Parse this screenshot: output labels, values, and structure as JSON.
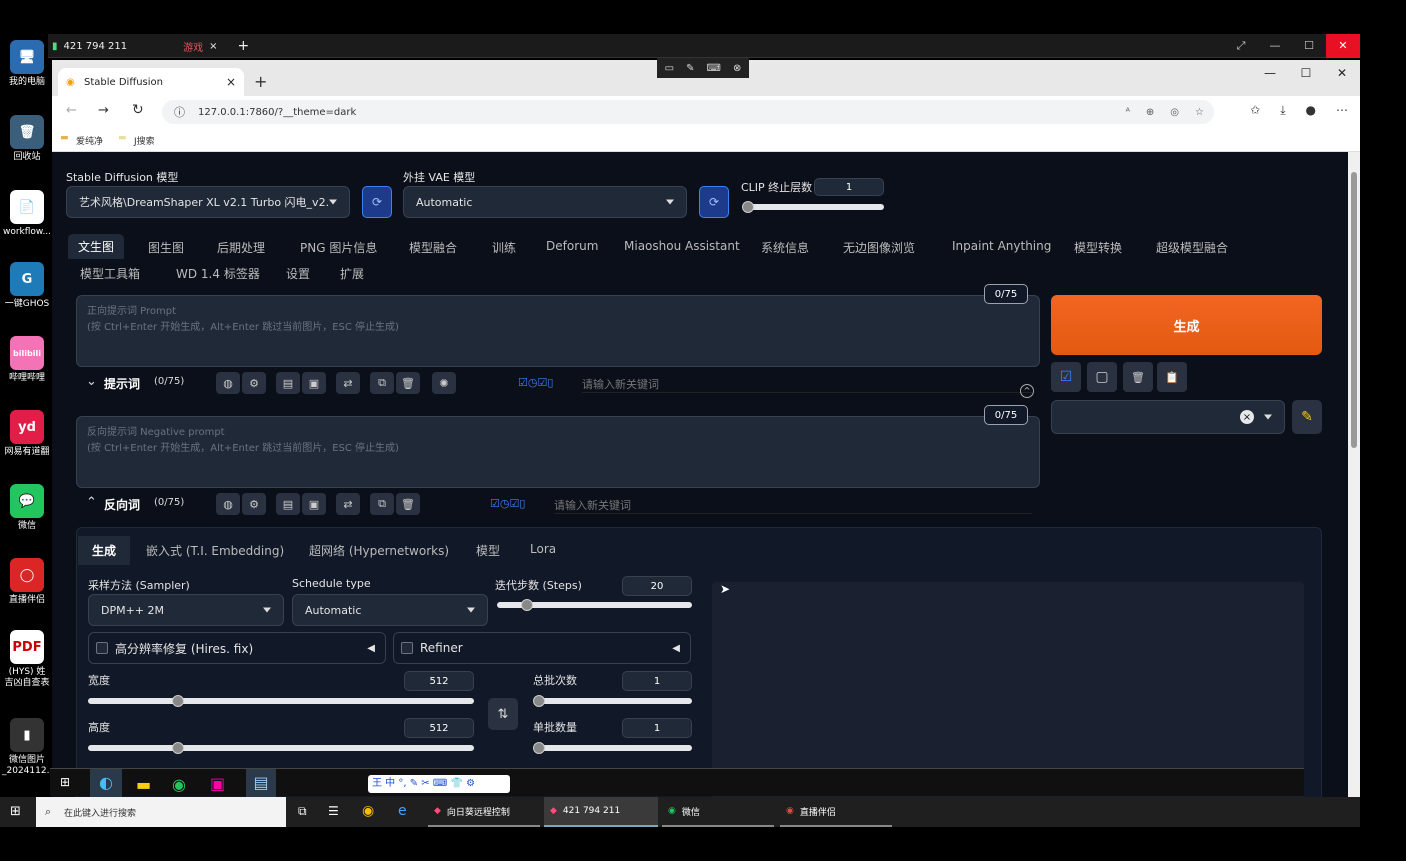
{
  "desktop": {
    "icons": [
      {
        "label": "我的电脑",
        "glyph": "🖥"
      },
      {
        "label": "回收站",
        "glyph": "🗑"
      },
      {
        "label": "workflow...",
        "glyph": "📄"
      },
      {
        "label": "一键GHOS",
        "glyph": "G"
      },
      {
        "label": "哔哩哔哩",
        "glyph": "bilibili"
      },
      {
        "label": "网易有道翻",
        "glyph": "yd"
      },
      {
        "label": "微信",
        "glyph": "💬"
      },
      {
        "label": "直播伴侣",
        "glyph": "◯"
      },
      {
        "label": "(HYS) 姓\n吉凶自查表",
        "glyph": "PDF"
      },
      {
        "label": "微信图片\n_2024112...",
        "glyph": "▮"
      }
    ]
  },
  "remote": {
    "tab_label": "421 794 211",
    "tab_tag": "游戏",
    "tab_close": "×",
    "new_tab": "+"
  },
  "browser": {
    "tab_title": "Stable Diffusion",
    "tab_close": "×",
    "new_tab": "+",
    "url": "127.0.0.1:7860/?__theme=dark",
    "bookmarks": [
      "爱纯净",
      "J搜索"
    ]
  },
  "sd": {
    "model_label": "Stable Diffusion 模型",
    "model_value": "艺术风格\\DreamShaper XL v2.1 Turbo 闪电_v2.",
    "vae_label": "外挂 VAE 模型",
    "vae_value": "Automatic",
    "clip_label": "CLIP 终止层数",
    "clip_value": "1",
    "main_tabs_row1": [
      "文生图",
      "图生图",
      "后期处理",
      "PNG 图片信息",
      "模型融合",
      "训练",
      "Deforum",
      "Miaoshou Assistant",
      "系统信息",
      "无边图像浏览",
      "Inpaint Anything",
      "模型转换",
      "超级模型融合"
    ],
    "main_tabs_row2": [
      "模型工具箱",
      "WD 1.4 标签器",
      "设置",
      "扩展"
    ],
    "prompt": {
      "placeholder_line1": "正向提示词 Prompt",
      "placeholder_line2": "(按 Ctrl+Enter 开始生成，Alt+Enter 跳过当前图片，ESC 停止生成)",
      "counter": "0/75",
      "section_label": "提示词",
      "section_count": "(0/75)",
      "keyword_placeholder": "请输入新关键词"
    },
    "negative": {
      "placeholder_line1": "反向提示词 Negative prompt",
      "placeholder_line2": "(按 Ctrl+Enter 开始生成，Alt+Enter 跳过当前图片，ESC 停止生成)",
      "counter": "0/75",
      "section_label": "反向词",
      "section_count": "(0/75)",
      "keyword_placeholder": "请输入新关键词"
    },
    "generate_label": "生成",
    "sub_tabs": [
      "生成",
      "嵌入式 (T.I. Embedding)",
      "超网络 (Hypernetworks)",
      "模型",
      "Lora"
    ],
    "sampler_label": "采样方法 (Sampler)",
    "sampler_value": "DPM++ 2M",
    "schedule_label": "Schedule type",
    "schedule_value": "Automatic",
    "steps_label": "迭代步数 (Steps)",
    "steps_value": "20",
    "hires_label": "高分辨率修复 (Hires. fix)",
    "refiner_label": "Refiner",
    "width_label": "宽度",
    "width_value": "512",
    "height_label": "高度",
    "height_value": "512",
    "batch_count_label": "总批次数",
    "batch_count_value": "1",
    "batch_size_label": "单批数量",
    "batch_size_value": "1",
    "style_clear": "×"
  },
  "taskbar": {
    "search_placeholder": "在此键入进行搜索",
    "items": [
      "向日葵远程控制",
      "421 794 211",
      "微信",
      "直播伴侣"
    ]
  },
  "colors": {
    "accent_orange": "#f26522",
    "page_bg": "#0b0f19",
    "panel": "#1f2937"
  }
}
